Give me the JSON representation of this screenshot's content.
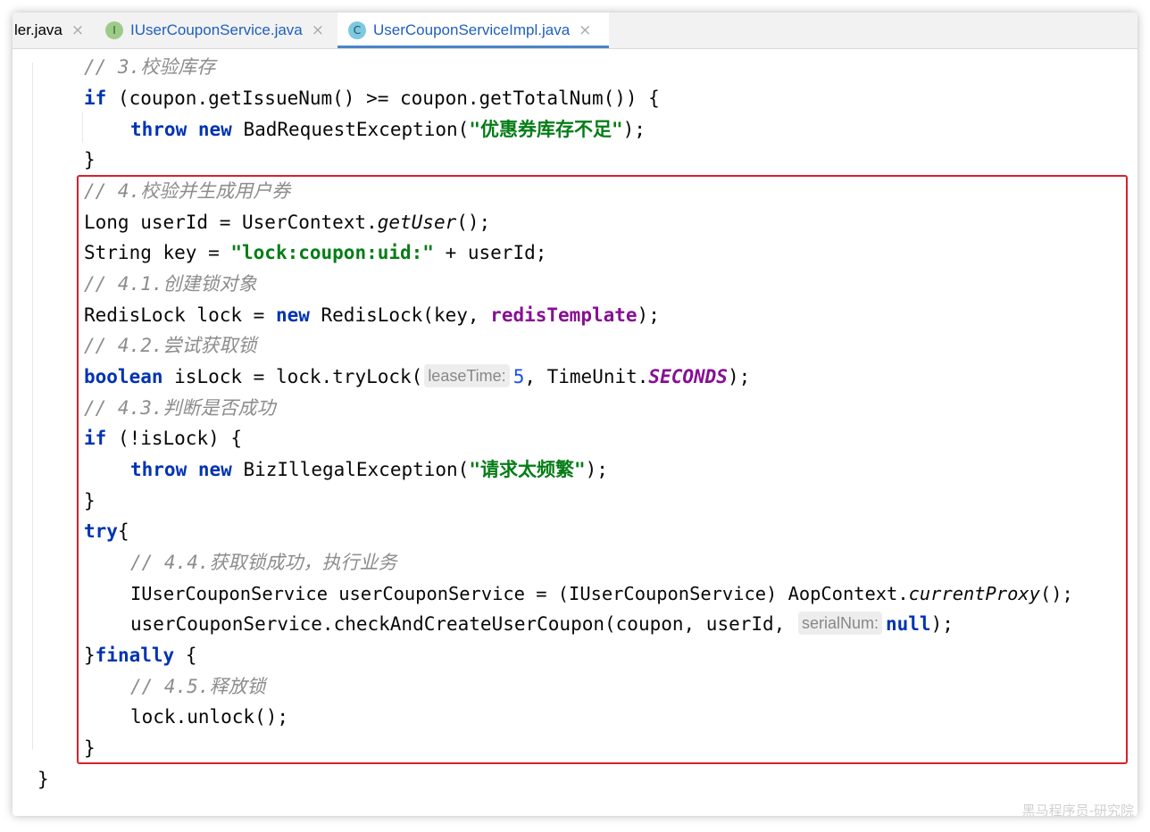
{
  "tabs": [
    {
      "label": "ler.java",
      "icon": "",
      "active": false
    },
    {
      "label": "IUserCouponService.java",
      "icon": "I",
      "icon_name": "interface-icon",
      "active": false
    },
    {
      "label": "UserCouponServiceImpl.java",
      "icon": "C",
      "icon_name": "class-icon",
      "active": true
    }
  ],
  "close_glyph": "×",
  "code": {
    "l1": "// 3.校验库存",
    "l2": {
      "kw": "if",
      "rest": " (coupon.getIssueNum() >= coupon.getTotalNum()) {"
    },
    "l3": {
      "kw1": "throw",
      "kw2": "new",
      "mid": " BadRequestException(",
      "str": "\"优惠券库存不足\"",
      "end": ");"
    },
    "l4": "}",
    "l5": "// 4.校验并生成用户券",
    "l6": {
      "pre": "Long userId = UserContext.",
      "it": "getUser",
      "end": "();"
    },
    "l7": {
      "pre": "String key = ",
      "str": "\"lock:coupon:uid:\"",
      "end": " + userId;"
    },
    "l8": "// 4.1.创建锁对象",
    "l9": {
      "pre": "RedisLock lock = ",
      "kw": "new",
      "mid": " RedisLock(key, ",
      "fld": "redisTemplate",
      "end": ");"
    },
    "l10": "// 4.2.尝试获取锁",
    "l11": {
      "kw": "boolean",
      "mid": " isLock = lock.tryLock(",
      "hint": "leaseTime:",
      "num": "5",
      "mid2": ", TimeUnit.",
      "sfld": "SECONDS",
      "end": ");"
    },
    "l12": "// 4.3.判断是否成功",
    "l13": {
      "kw": "if",
      "rest": " (!isLock) {"
    },
    "l14": {
      "kw1": "throw",
      "kw2": "new",
      "mid": " BizIllegalException(",
      "str": "\"请求太频繁\"",
      "end": ");"
    },
    "l15": "}",
    "l16": {
      "kw": "try",
      "rest": "{"
    },
    "l17": "// 4.4.获取锁成功，执行业务",
    "l18": {
      "pre": "IUserCouponService userCouponService = (IUserCouponService) AopContext.",
      "it": "currentProxy",
      "end": "();"
    },
    "l19": {
      "pre": "userCouponService.checkAndCreateUserCoupon(coupon, userId, ",
      "hint": "serialNum:",
      "kw": "null",
      "end": ");"
    },
    "l20": {
      "pre": "}",
      "kw": "finally",
      "rest": " {"
    },
    "l21": "// 4.5.释放锁",
    "l22": "lock.unlock();",
    "l23": "}",
    "l24": "}"
  },
  "watermark": "黑马程序员-研究院",
  "colors": {
    "keyword": "#0033b3",
    "string": "#067d17",
    "comment": "#8c8c8c",
    "field": "#871094",
    "highlight_border": "#d9202a",
    "active_tab_underline": "#4a86c8"
  }
}
